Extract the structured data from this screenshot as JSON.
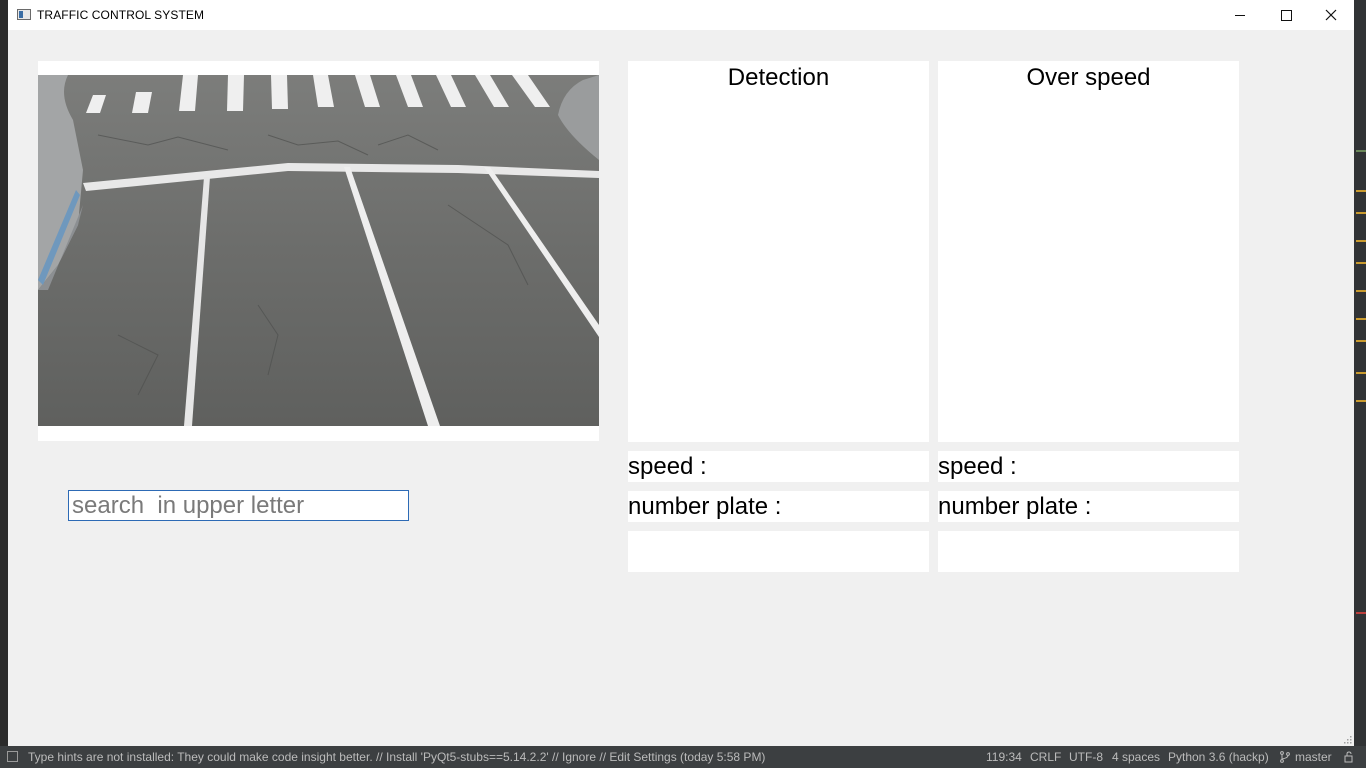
{
  "window": {
    "title": "TRAFFIC CONTROL SYSTEM"
  },
  "search": {
    "placeholder": "search  in upper letter",
    "value": ""
  },
  "detection_panel": {
    "title": "Detection",
    "speed_label": "speed :",
    "plate_label": "number plate :"
  },
  "overspeed_panel": {
    "title": "Over speed",
    "speed_label": "speed :",
    "plate_label": "number plate :"
  },
  "statusbar": {
    "message": "Type hints are not installed: They could make code insight better. // Install 'PyQt5-stubs==5.14.2.2' // Ignore // Edit Settings (today 5:58 PM)",
    "position": "119:34",
    "line_ending": "CRLF",
    "encoding": "UTF-8",
    "indent": "4 spaces",
    "interpreter": "Python 3.6 (hackp)",
    "branch": "master"
  }
}
